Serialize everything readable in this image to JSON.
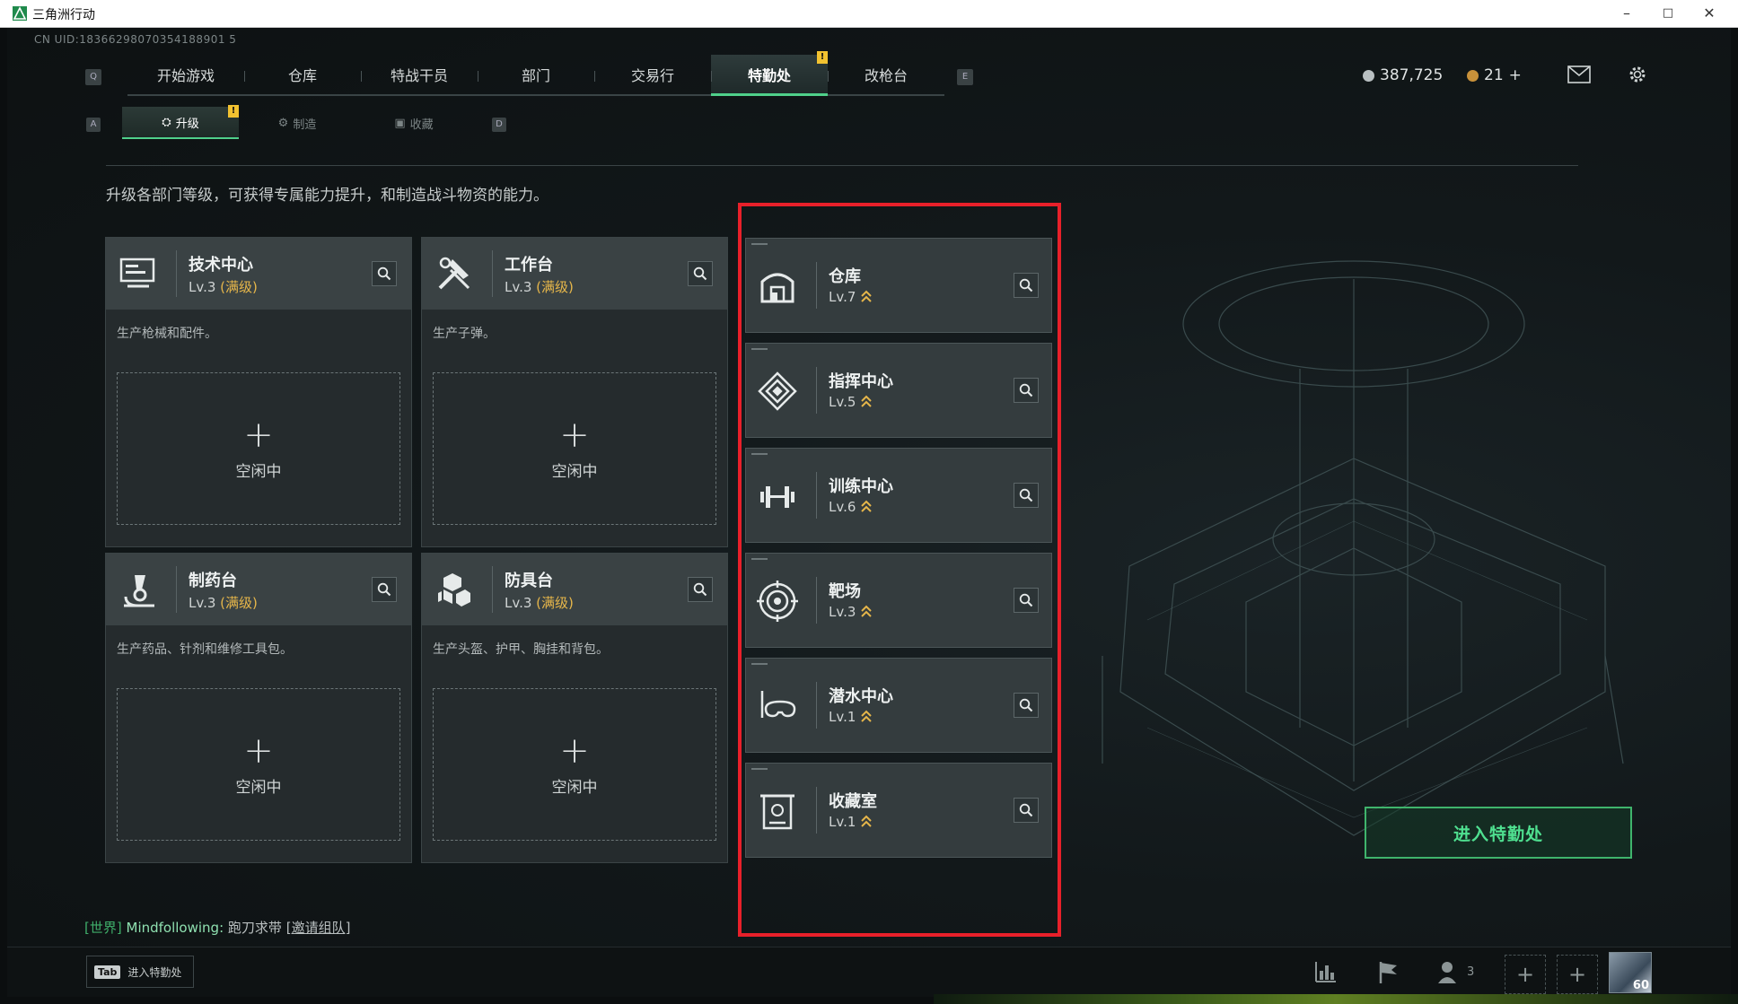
{
  "window": {
    "title": "三角洲行动",
    "minimize": "–",
    "maximize": "□",
    "close": "✕"
  },
  "uid": "CN UID:18366298070354188901 5",
  "nav": {
    "left_key": "Q",
    "right_key": "E",
    "tabs": [
      {
        "label": "开始游戏"
      },
      {
        "label": "仓库"
      },
      {
        "label": "特战干员"
      },
      {
        "label": "部门"
      },
      {
        "label": "交易行"
      },
      {
        "label": "特勤处",
        "active": true,
        "badge": "!"
      },
      {
        "label": "改枪台"
      }
    ]
  },
  "currency": {
    "silver": "387,725",
    "gold": "21",
    "gold_add": "+"
  },
  "subnav": {
    "left_key": "A",
    "right_key": "D",
    "tabs": [
      {
        "label": "升级",
        "active": true,
        "badge": "!"
      },
      {
        "label": "制造"
      },
      {
        "label": "收藏"
      }
    ]
  },
  "description": "升级各部门等级，可获得专属能力提升，和制造战斗物资的能力。",
  "workshops": [
    {
      "name": "技术中心",
      "level": "Lv.3",
      "max": "(满级)",
      "info": "生产枪械和配件。",
      "slot_plus": "+",
      "slot_status": "空闲中"
    },
    {
      "name": "工作台",
      "level": "Lv.3",
      "max": "(满级)",
      "info": "生产子弹。",
      "slot_plus": "+",
      "slot_status": "空闲中"
    },
    {
      "name": "制药台",
      "level": "Lv.3",
      "max": "(满级)",
      "info": "生产药品、针剂和维修工具包。",
      "slot_plus": "+",
      "slot_status": "空闲中"
    },
    {
      "name": "防具台",
      "level": "Lv.3",
      "max": "(满级)",
      "info": "生产头盔、护甲、胸挂和背包。",
      "slot_plus": "+",
      "slot_status": "空闲中"
    }
  ],
  "departments": [
    {
      "name": "仓库",
      "level": "Lv.7"
    },
    {
      "name": "指挥中心",
      "level": "Lv.5"
    },
    {
      "name": "训练中心",
      "level": "Lv.6"
    },
    {
      "name": "靶场",
      "level": "Lv.3"
    },
    {
      "name": "潜水中心",
      "level": "Lv.1"
    },
    {
      "name": "收藏室",
      "level": "Lv.1"
    }
  ],
  "enter_button": "进入特勤处",
  "chat": {
    "channel": "[世界]",
    "user": "Mindfollowing:",
    "message": "跑刀求带",
    "link": "[邀请组队]"
  },
  "bottom": {
    "tab_key": "Tab",
    "tab_label": "进入特勤处",
    "friends_count": "3",
    "player_level": "60"
  },
  "colors": {
    "accent_green": "#4fd08a",
    "max_gold": "#e6b64a",
    "highlight_red": "#e8202a"
  }
}
